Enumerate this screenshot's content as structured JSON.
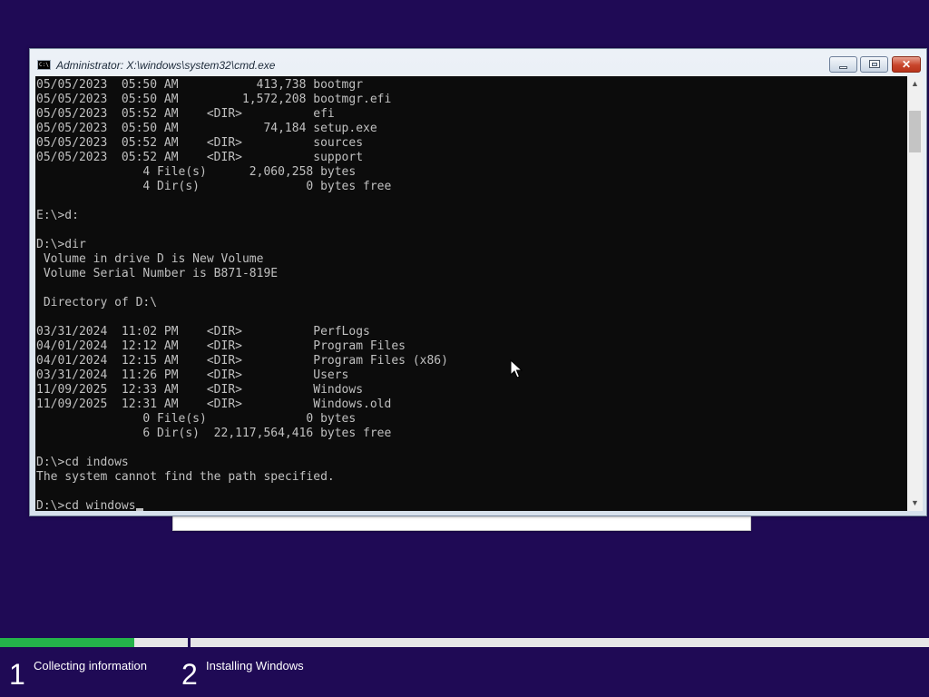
{
  "window": {
    "title": "Administrator: X:\\windows\\system32\\cmd.exe",
    "icon": "cmd-icon",
    "icon_text": "C:\\",
    "controls": {
      "minimize": "minimize-icon",
      "maximize": "maximize-icon",
      "close": "close-icon"
    },
    "close_glyph": "✕"
  },
  "console": {
    "lines": [
      "05/05/2023  05:50 AM           413,738 bootmgr",
      "05/05/2023  05:50 AM         1,572,208 bootmgr.efi",
      "05/05/2023  05:52 AM    <DIR>          efi",
      "05/05/2023  05:50 AM            74,184 setup.exe",
      "05/05/2023  05:52 AM    <DIR>          sources",
      "05/05/2023  05:52 AM    <DIR>          support",
      "               4 File(s)      2,060,258 bytes",
      "               4 Dir(s)               0 bytes free",
      "",
      "E:\\>d:",
      "",
      "D:\\>dir",
      " Volume in drive D is New Volume",
      " Volume Serial Number is B871-819E",
      "",
      " Directory of D:\\",
      "",
      "03/31/2024  11:02 PM    <DIR>          PerfLogs",
      "04/01/2024  12:12 AM    <DIR>          Program Files",
      "04/01/2024  12:15 AM    <DIR>          Program Files (x86)",
      "03/31/2024  11:26 PM    <DIR>          Users",
      "11/09/2025  12:33 AM    <DIR>          Windows",
      "11/09/2025  12:31 AM    <DIR>          Windows.old",
      "               0 File(s)              0 bytes",
      "               6 Dir(s)  22,117,564,416 bytes free",
      "",
      "D:\\>cd indows",
      "The system cannot find the path specified.",
      ""
    ],
    "current_input": "D:\\>cd windows",
    "scroll_up_glyph": "▲",
    "scroll_down_glyph": "▼"
  },
  "setup": {
    "progress_fraction": 0.145,
    "steps": [
      {
        "number": "1",
        "label": "Collecting information"
      },
      {
        "number": "2",
        "label": "Installing Windows"
      }
    ]
  },
  "colors": {
    "desktop_bg": "#1f0a55",
    "console_bg": "#0c0c0c",
    "console_text": "#c0c0c0",
    "progress": "#24b34a"
  }
}
